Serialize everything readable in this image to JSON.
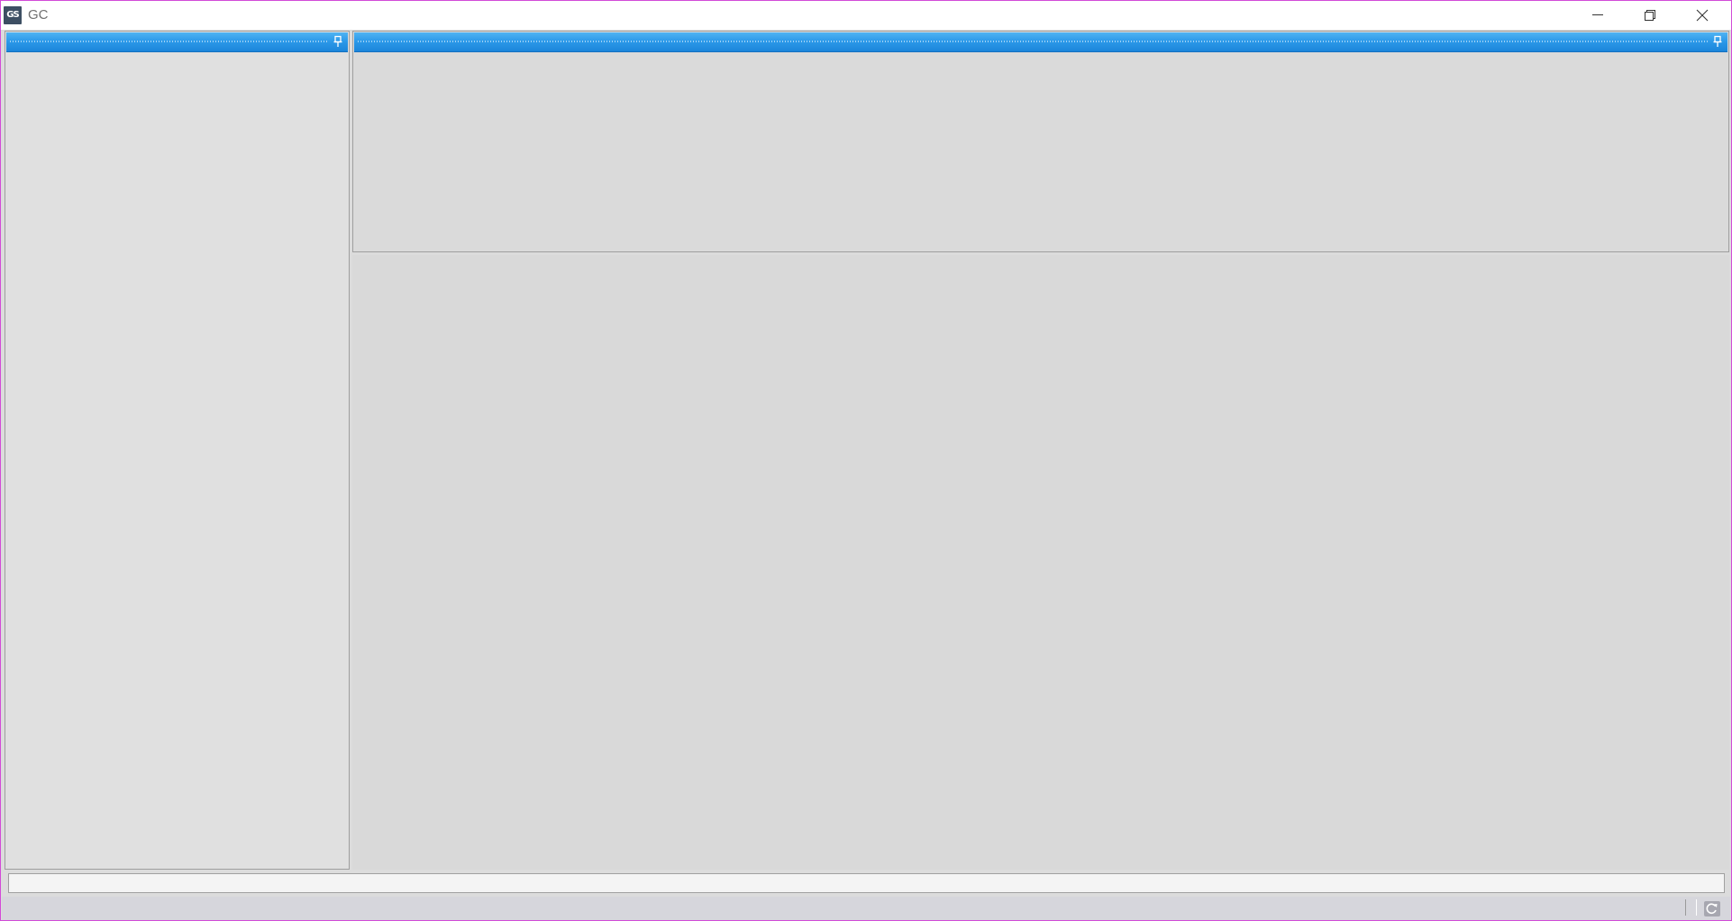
{
  "window": {
    "title": "GC",
    "app_icon_text": "GS",
    "controls": [
      "minimize-icon",
      "restore-icon",
      "close-icon"
    ]
  },
  "panels": {
    "left": {
      "header_title": "",
      "pin_icon": "pin-icon"
    },
    "top": {
      "header_title": "",
      "pin_icon": "pin-icon"
    }
  },
  "input_bar": {
    "value": "",
    "placeholder": ""
  },
  "status_bar": {
    "text": "",
    "refresh_icon": "refresh-icon"
  },
  "colors": {
    "header_blue": "#2d9ae9",
    "window_border": "#d24bd8",
    "panel_bg": "#e0e0e0"
  }
}
